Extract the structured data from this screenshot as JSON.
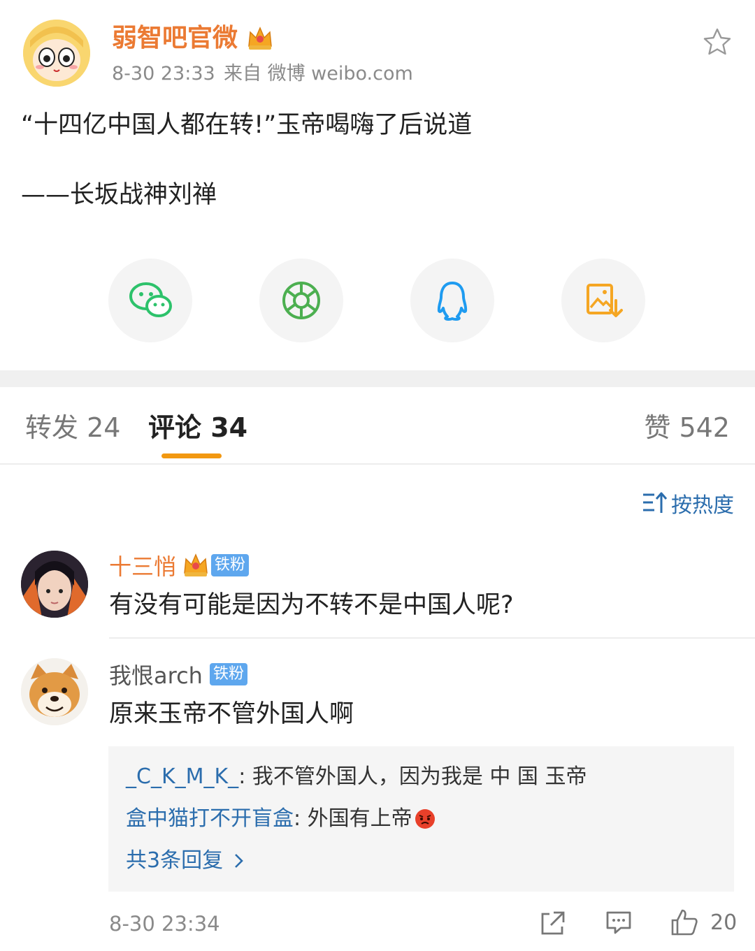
{
  "post": {
    "author": "弱智吧官微",
    "time": "8-30 23:33",
    "source": "来自 微博 weibo.com",
    "line1": "“十四亿中国人都在转!”玉帝喝嗨了后说道",
    "line2": "——长坂战神刘禅"
  },
  "share_icons": [
    "wechat-icon",
    "moments-icon",
    "qq-icon",
    "save-image-icon"
  ],
  "tabs": {
    "repost": "转发 24",
    "comment": "评论 34",
    "like": "赞 542"
  },
  "sort": {
    "label": "按热度"
  },
  "comments": [
    {
      "user": "十三悄",
      "badge": "铁粉",
      "text": "有没有可能是因为不转不是中国人呢?"
    },
    {
      "user": "我恨arch",
      "badge": "铁粉",
      "text": "原来玉帝不管外国人啊",
      "replies": [
        {
          "user": "_C_K_M_K_",
          "text": ": 我不管外国人，因为我是 中 国 玉帝"
        },
        {
          "user": "盒中猫打不开盲盒",
          "text": ": 外国有上帝"
        }
      ],
      "more": "共3条回复",
      "time": "8-30 23:34",
      "likes": "20"
    }
  ],
  "colors": {
    "accent": "#f29811",
    "name": "#eb7a33",
    "link": "#2b6dad",
    "badge": "#5ea7ee"
  }
}
